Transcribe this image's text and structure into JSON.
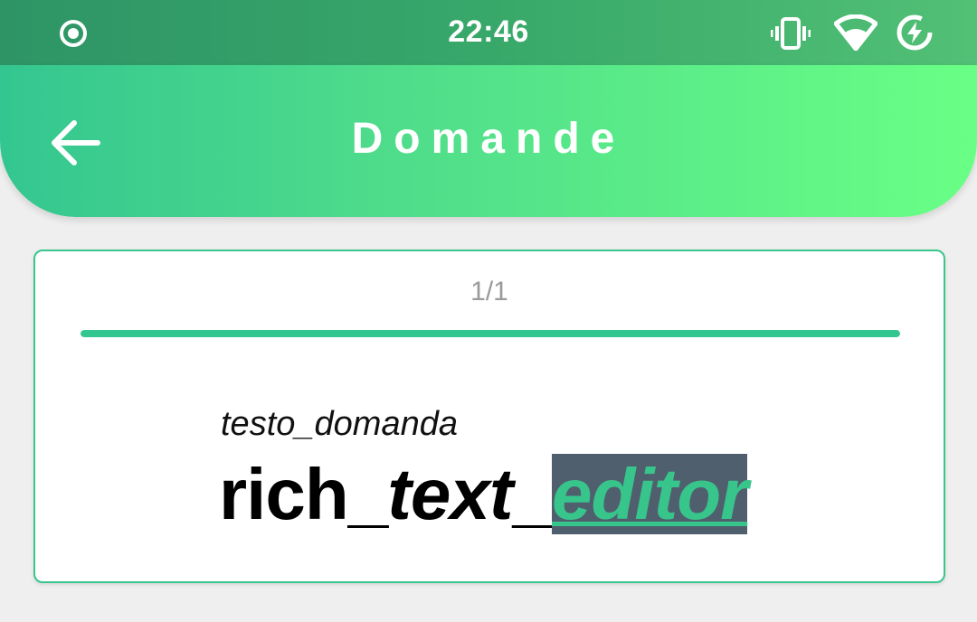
{
  "status_bar": {
    "time": "22:46",
    "icons": [
      "record-icon",
      "vibrate-icon",
      "wifi-icon",
      "battery-saver-icon"
    ]
  },
  "header": {
    "title": "Domande",
    "back_icon": "arrow-left-icon",
    "gradient_start": "#34c690",
    "gradient_end": "#69ff85"
  },
  "card": {
    "counter": "1/1",
    "progress": 1.0,
    "question_label": "testo_domanda",
    "rich_text": {
      "part1": "rich_",
      "part2": "text",
      "part3": "_",
      "part4": "editor"
    },
    "accent_color": "#34c690",
    "highlight_bg": "#4f5f6e"
  }
}
